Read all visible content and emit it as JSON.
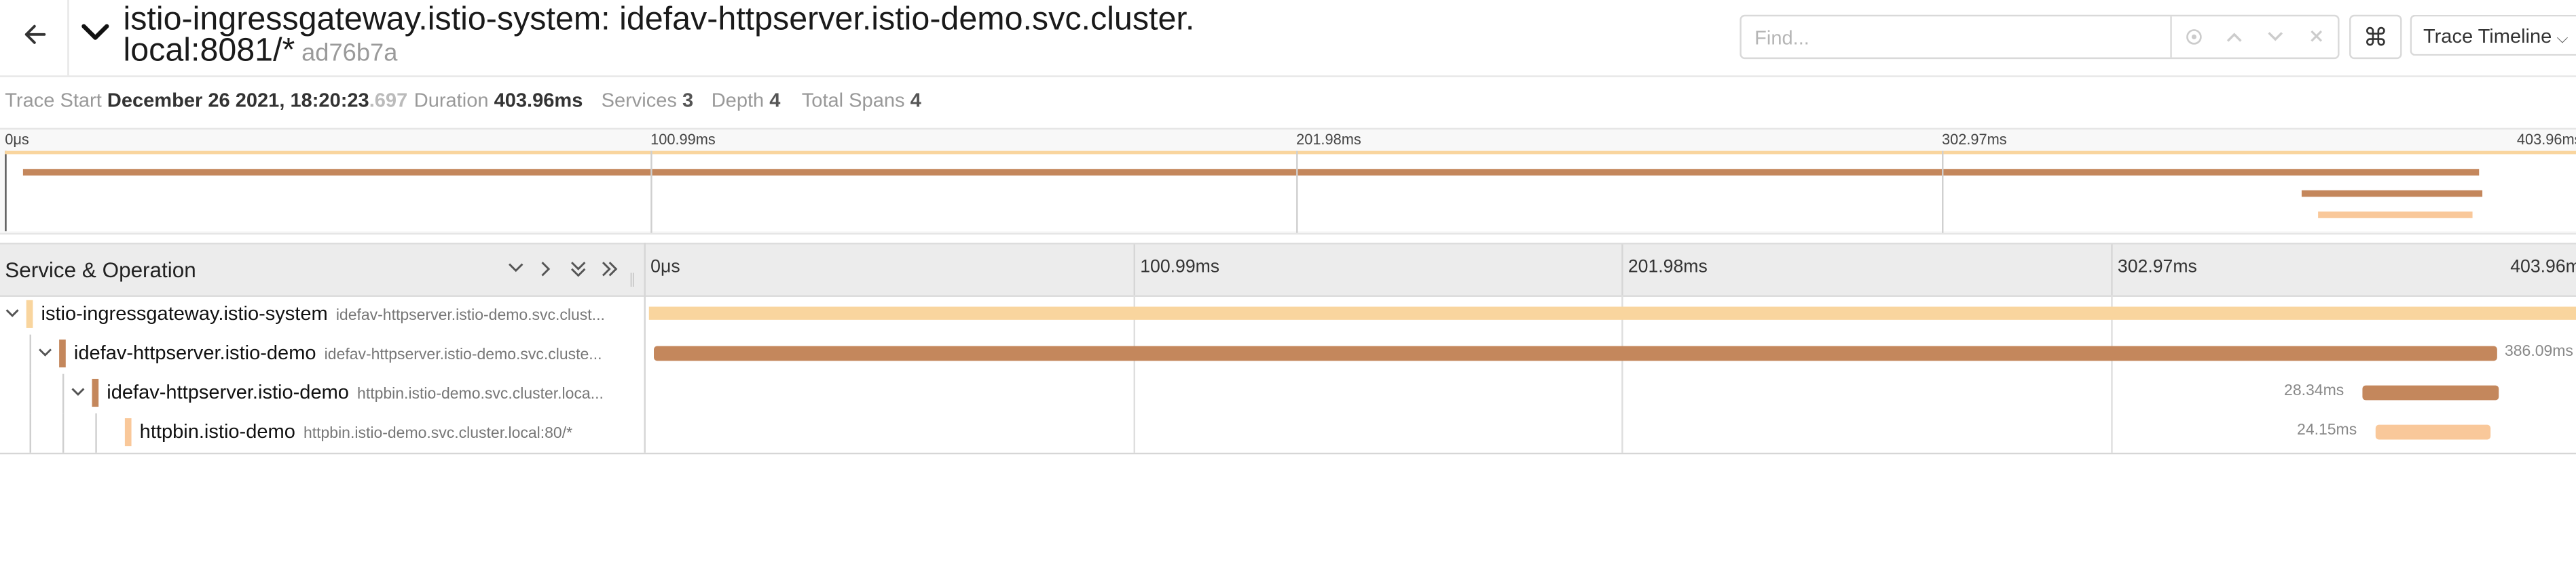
{
  "colors": {
    "gateway": "#f9d59e",
    "httpserver": "#c4875c",
    "httpbin": "#f9c89a",
    "guide": "#cfcfcf",
    "accent_text": "#333333"
  },
  "header": {
    "back_icon": "arrow-left-icon",
    "collapse_icon": "chevron-down-icon",
    "title": "istio-ingressgateway.istio-system: idefav-httpserver.istio-demo.svc.cluster. local:8081/*",
    "trace_id": "ad76b7a",
    "find_placeholder": "Find...",
    "find_controls": [
      "target-icon",
      "chevron-up-icon",
      "chevron-down-icon",
      "close-icon"
    ],
    "keyboard_icon": "command-icon",
    "keyboard_glyph": "⌘",
    "view_select": "Trace Timeline"
  },
  "summary": {
    "trace_start_label": "Trace Start",
    "trace_start_value": "December 26 2021, 18:20:23",
    "trace_start_ms": ".697",
    "duration_label": "Duration",
    "duration_value": "403.96ms",
    "services_label": "Services",
    "services_value": "3",
    "depth_label": "Depth",
    "depth_value": "4",
    "total_spans_label": "Total Spans",
    "total_spans_value": "4"
  },
  "minimap": {
    "ticks": [
      "0μs",
      "100.99ms",
      "201.98ms",
      "302.97ms",
      "403.96ms"
    ]
  },
  "timeline": {
    "column_title": "Service & Operation",
    "collapse_controls": [
      "chevron-down-icon",
      "chevron-right-icon",
      "double-chevron-down-icon",
      "double-chevron-right-icon"
    ],
    "ticks": [
      "0μs",
      "100.99ms",
      "201.98ms",
      "302.97ms",
      "403.96ms"
    ],
    "total_ms": 403.96,
    "spans": [
      {
        "service": "istio-ingressgateway.istio-system",
        "operation": "idefav-httpserver.istio-demo.svc.clust...",
        "depth": 0,
        "start_ms": 0,
        "duration_ms": 403.96,
        "label": "",
        "color": "#f9d59e",
        "toggle": true
      },
      {
        "service": "idefav-httpserver.istio-demo",
        "operation": "idefav-httpserver.istio-demo.svc.cluste...",
        "depth": 1,
        "start_ms": 1.2,
        "duration_ms": 386.09,
        "label": "386.09ms",
        "color": "#c4875c",
        "toggle": true
      },
      {
        "service": "idefav-httpserver.istio-demo",
        "operation": "httpbin.istio-demo.svc.cluster.loca...",
        "depth": 2,
        "start_ms": 359.3,
        "duration_ms": 28.34,
        "label": "28.34ms",
        "color": "#c4875c",
        "toggle": true
      },
      {
        "service": "httpbin.istio-demo",
        "operation": "httpbin.istio-demo.svc.cluster.local:80/*",
        "depth": 3,
        "start_ms": 362.0,
        "duration_ms": 24.15,
        "label": "24.15ms",
        "color": "#f9c89a",
        "toggle": false
      }
    ]
  }
}
